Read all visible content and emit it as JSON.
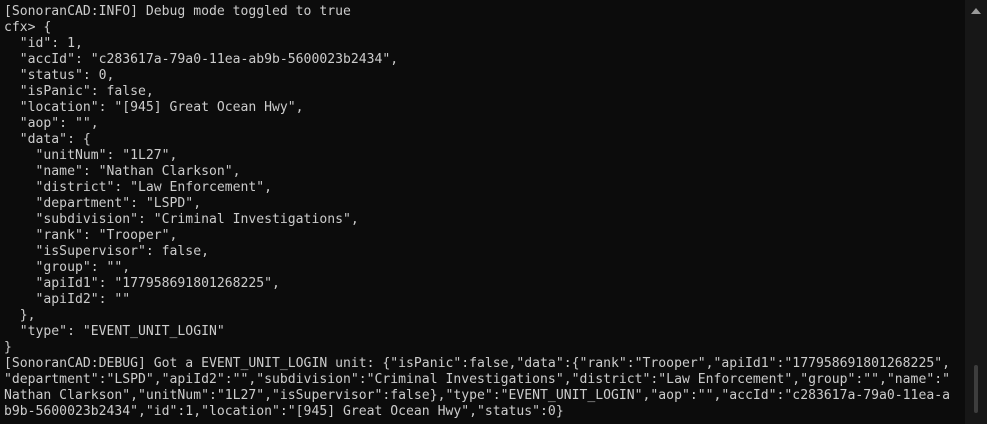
{
  "console": {
    "lines": [
      "[SonoranCAD:INFO] Debug mode toggled to true",
      "cfx> {",
      "  \"id\": 1,",
      "  \"accId\": \"c283617a-79a0-11ea-ab9b-5600023b2434\",",
      "  \"status\": 0,",
      "  \"isPanic\": false,",
      "  \"location\": \"[945] Great Ocean Hwy\",",
      "  \"aop\": \"\",",
      "  \"data\": {",
      "    \"unitNum\": \"1L27\",",
      "    \"name\": \"Nathan Clarkson\",",
      "    \"district\": \"Law Enforcement\",",
      "    \"department\": \"LSPD\",",
      "    \"subdivision\": \"Criminal Investigations\",",
      "    \"rank\": \"Trooper\",",
      "    \"isSupervisor\": false,",
      "    \"group\": \"\",",
      "    \"apiId1\": \"177958691801268225\",",
      "    \"apiId2\": \"\"",
      "  },",
      "  \"type\": \"EVENT_UNIT_LOGIN\"",
      "}",
      "[SonoranCAD:DEBUG] Got a EVENT_UNIT_LOGIN unit: {\"isPanic\":false,\"data\":{\"rank\":\"Trooper\",\"apiId1\":\"177958691801268225\",",
      "\"department\":\"LSPD\",\"apiId2\":\"\",\"subdivision\":\"Criminal Investigations\",\"district\":\"Law Enforcement\",\"group\":\"\",\"name\":\"",
      "Nathan Clarkson\",\"unitNum\":\"1L27\",\"isSupervisor\":false},\"type\":\"EVENT_UNIT_LOGIN\",\"aop\":\"\",\"accId\":\"c283617a-79a0-11ea-a",
      "b9b-5600023b2434\",\"id\":1,\"location\":\"[945] Great Ocean Hwy\",\"status\":0}"
    ]
  },
  "scrollbar": {
    "position": 0.97,
    "visible_fraction": 0.12
  },
  "colors": {
    "background": "#0c0c0c",
    "text": "#cccccc",
    "scrollbar_track": "#171717",
    "scrollbar_thumb": "#3d3d3d"
  },
  "icons": {
    "scroll_up": "up-arrow-icon"
  }
}
